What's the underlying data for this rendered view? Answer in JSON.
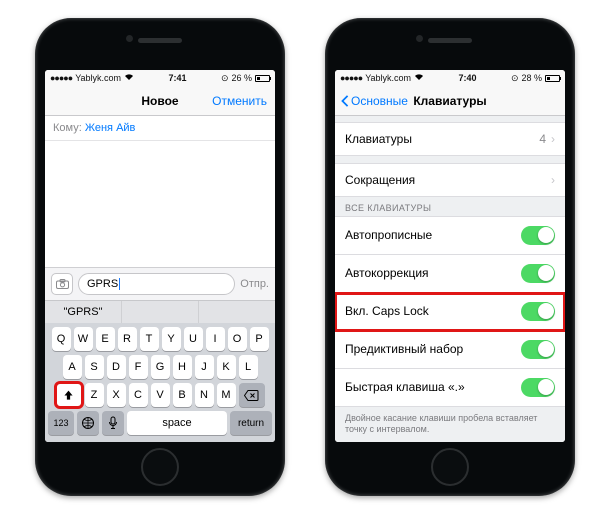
{
  "left": {
    "status": {
      "carrier": "Yablyk.com",
      "time": "7:41",
      "battery_pct": "26 %"
    },
    "nav": {
      "title": "Новое",
      "cancel": "Отменить"
    },
    "to": {
      "label": "Кому:",
      "value": "Женя Айв"
    },
    "msg": {
      "value": "GPRS",
      "send": "Отпр."
    },
    "predictive": {
      "a": "\"GPRS\"",
      "b": "",
      "c": ""
    },
    "kbd": {
      "r1": [
        "Q",
        "W",
        "E",
        "R",
        "T",
        "Y",
        "U",
        "I",
        "O",
        "P"
      ],
      "r2": [
        "A",
        "S",
        "D",
        "F",
        "G",
        "H",
        "J",
        "K",
        "L"
      ],
      "r3": [
        "Z",
        "X",
        "C",
        "V",
        "B",
        "N",
        "M"
      ],
      "r4": {
        "n": "123",
        "space": "space",
        "ret": "return"
      }
    }
  },
  "right": {
    "status": {
      "carrier": "Yablyk.com",
      "time": "7:40",
      "battery_pct": "28 %"
    },
    "nav": {
      "back": "Основные",
      "title": "Клавиатуры"
    },
    "rows": {
      "keyboards": {
        "label": "Клавиатуры",
        "value": "4"
      },
      "shortcuts": {
        "label": "Сокращения"
      }
    },
    "group_header": "ВСЕ КЛАВИАТУРЫ",
    "toggles": {
      "auto_cap": "Автопрописные",
      "auto_corr": "Автокоррекция",
      "caps_lock": "Вкл. Caps Lock",
      "predictive": "Предиктивный набор",
      "quick_period": "Быстрая клавиша «.»"
    },
    "footnote": "Двойное касание клавиши пробела вставляет точку с интервалом."
  },
  "colors": {
    "accent": "#0079ff",
    "switch_on": "#4cd964",
    "highlight": "#e01616"
  }
}
